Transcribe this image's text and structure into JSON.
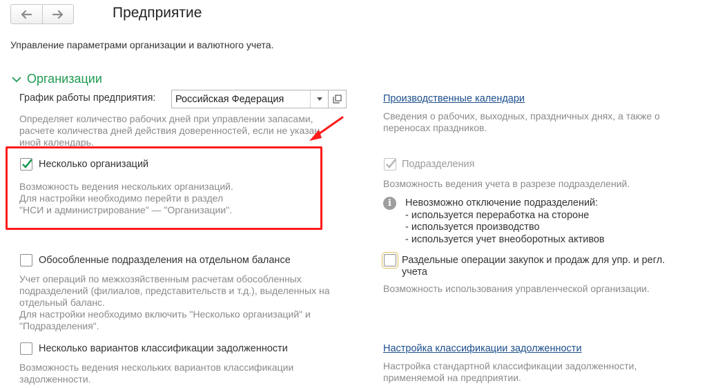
{
  "header": {
    "title": "Предприятие",
    "subtitle": "Управление параметрами организации и валютного учета.",
    "back_icon": "arrow-left-icon",
    "forward_icon": "arrow-right-icon"
  },
  "section": {
    "title": "Организации",
    "expanded": true
  },
  "schedule": {
    "label": "График работы предприятия:",
    "value": "Российская Федерация",
    "desc": [
      "Определяет количество рабочих дней при управлении запасами,",
      "расчете количества дней действия доверенностей, если не указан",
      "иной календарь."
    ]
  },
  "calendars": {
    "link": "Производственные календари",
    "desc": [
      "Сведения о рабочих, выходных, праздничных днях, а также о",
      "переносах праздников."
    ]
  },
  "multi_org": {
    "label": "Несколько организаций",
    "checked": true,
    "desc": [
      "Возможность ведения нескольких организаций.",
      "Для настройки необходимо перейти в раздел",
      "\"НСИ и администрирование\" — \"Организации\"."
    ]
  },
  "subdivisions": {
    "label": "Подразделения",
    "checked": true,
    "disabled": true,
    "desc": [
      "Возможность ведения учета в разрезе подразделений."
    ],
    "info": [
      "Невозможно отключение подразделений:",
      "- используется переработка на стороне",
      "- используется производство",
      "- используется учет внеоборотных активов"
    ]
  },
  "separate_units": {
    "label": "Обособленные подразделения на отдельном балансе",
    "checked": false,
    "desc": [
      "Учет операций по межхозяйственным расчетам обособленных",
      "подразделений (филиалов, представительств и т.д.), выделенных на",
      "отдельный баланс.",
      "Для настройки необходимо включить \"Несколько организаций\" и",
      "\"Подразделения\"."
    ]
  },
  "split_operations": {
    "label": [
      "Раздельные операции закупок и продаж для упр. и регл.",
      "учета"
    ],
    "checked": false,
    "desc": [
      "Возможность использования управленческой организации."
    ]
  },
  "debt_classification": {
    "label": "Несколько вариантов классификации задолженности",
    "checked": false,
    "desc": [
      "Возможность ведения нескольких вариантов классификации",
      "задолженности."
    ]
  },
  "debt_settings": {
    "link": "Настройка классификации задолженности",
    "desc": [
      "Настройка стандартной классификации задолженности,",
      "применяемой на предприятии."
    ]
  },
  "colors": {
    "section_green": "#1f9a52",
    "annotation_red": "#ff1a1a",
    "link_blue": "#1c4e8c",
    "check_green": "#1f9a52"
  }
}
